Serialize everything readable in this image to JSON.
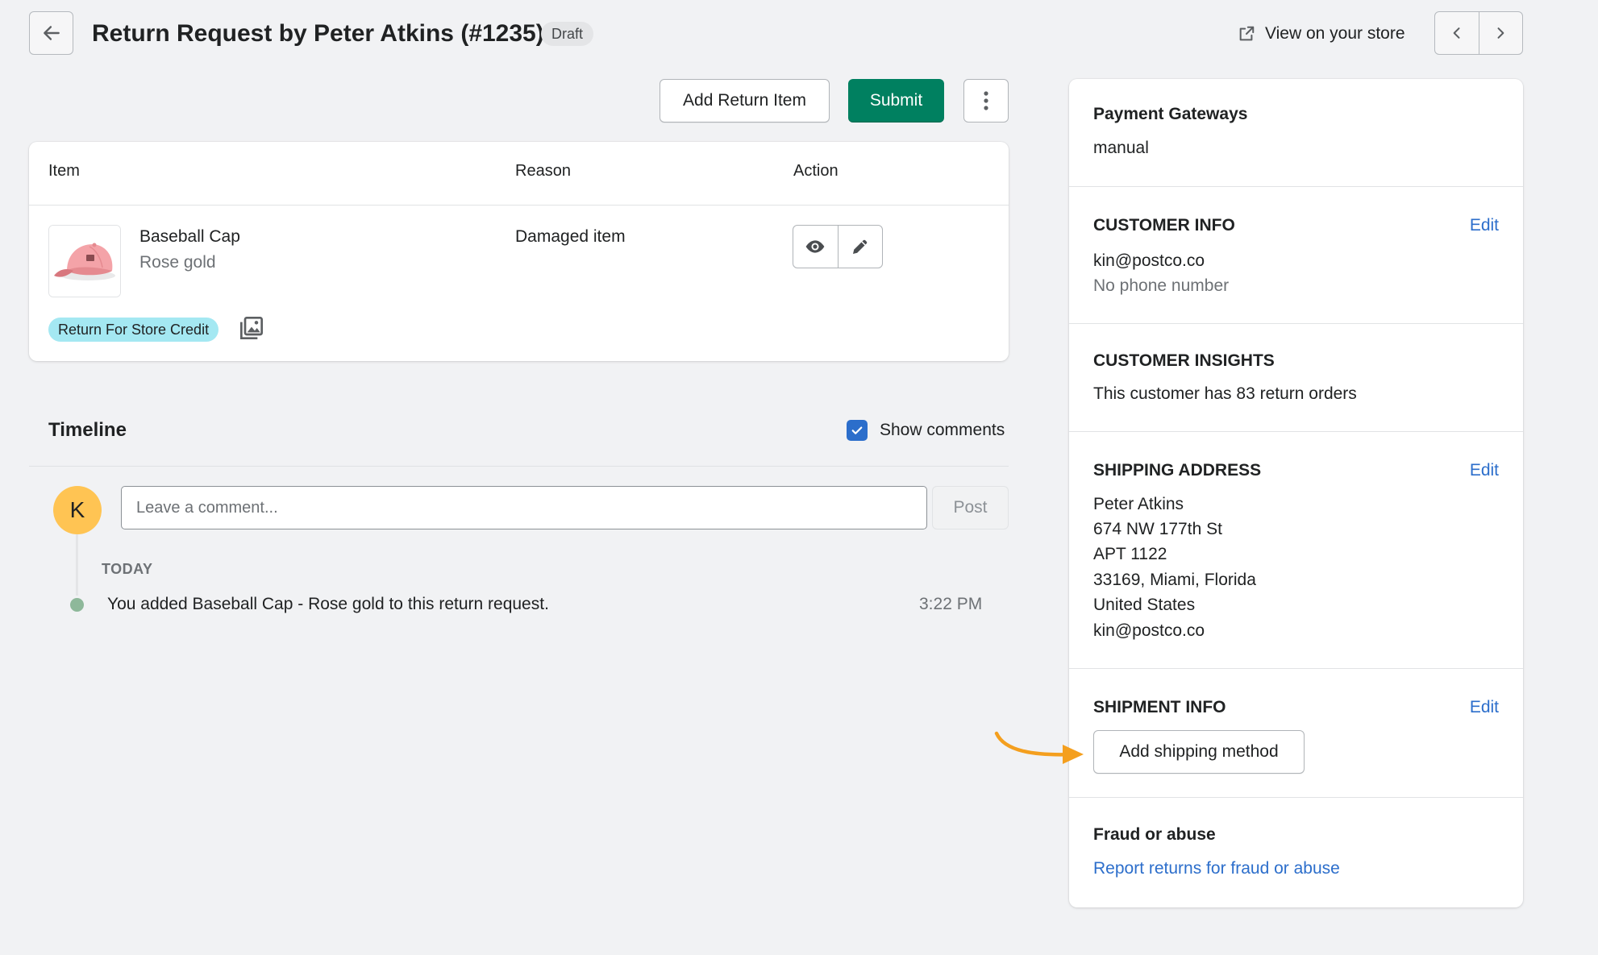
{
  "header": {
    "title": "Return Request by Peter Atkins (#1235)",
    "badge": "Draft",
    "view_store_label": "View on your store"
  },
  "toolbar": {
    "add_return_item_label": "Add Return Item",
    "submit_label": "Submit"
  },
  "items_table": {
    "columns": [
      "Item",
      "Reason",
      "Action"
    ],
    "rows": [
      {
        "name": "Baseball Cap",
        "variant": "Rose gold",
        "reason": "Damaged item",
        "badge": "Return For Store Credit"
      }
    ]
  },
  "timeline": {
    "title": "Timeline",
    "show_comments_label": "Show comments",
    "show_comments_checked": true,
    "avatar_initial": "K",
    "comment_placeholder": "Leave a comment...",
    "post_label": "Post",
    "group_label": "TODAY",
    "events": [
      {
        "text": "You added Baseball Cap - Rose gold to this return request.",
        "time": "3:22 PM"
      }
    ]
  },
  "sidebar": {
    "payment": {
      "heading": "Payment Gateways",
      "value": "manual"
    },
    "customer_info": {
      "heading": "CUSTOMER INFO",
      "edit_label": "Edit",
      "email": "kin@postco.co",
      "phone": "No phone number"
    },
    "customer_insights": {
      "heading": "CUSTOMER INSIGHTS",
      "text": "This customer has 83 return orders"
    },
    "shipping_address": {
      "heading": "SHIPPING ADDRESS",
      "edit_label": "Edit",
      "lines": [
        "Peter Atkins",
        "674 NW 177th St",
        "APT 1122",
        "33169, Miami, Florida",
        "United States",
        "kin@postco.co"
      ]
    },
    "shipment_info": {
      "heading": "SHIPMENT INFO",
      "edit_label": "Edit",
      "button_label": "Add shipping method"
    },
    "fraud": {
      "heading": "Fraud or abuse",
      "link_label": "Report returns for fraud or abuse"
    }
  },
  "colors": {
    "primary": "#008060",
    "link": "#2c6ecb",
    "badge_credit": "#a4e8f2",
    "avatar": "#ffc453",
    "annotation_arrow": "#f49f1e"
  }
}
